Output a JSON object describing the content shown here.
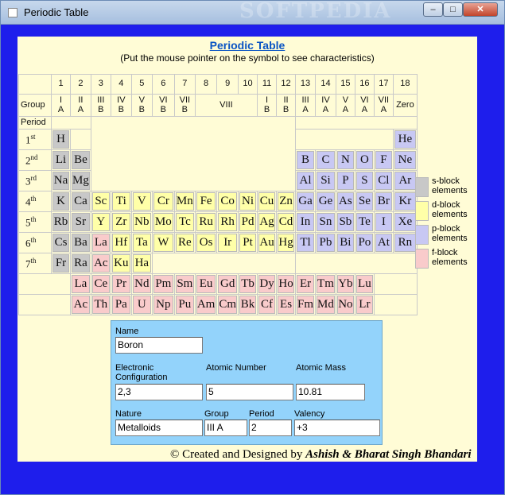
{
  "window": {
    "title": "Periodic Table",
    "watermark": "SOFTPEDIA",
    "minimize": "–",
    "maximize": "□",
    "close": "✕"
  },
  "header": {
    "title": "Periodic Table",
    "subtitle": "(Put the mouse pointer on the symbol to see characteristics)"
  },
  "table": {
    "group_label": "Group",
    "period_label": "Period",
    "zero_label": "Zero",
    "viii_label": "VIII",
    "group_numbers": [
      "1",
      "2",
      "3",
      "4",
      "5",
      "6",
      "7",
      "8",
      "9",
      "10",
      "11",
      "12",
      "13",
      "14",
      "15",
      "16",
      "17",
      "18"
    ],
    "group_names": [
      "I\nA",
      "II\nA",
      "III\nB",
      "IV\nB",
      "V\nB",
      "VI\nB",
      "VII\nB",
      "",
      "",
      "",
      "I\nB",
      "II\nB",
      "III\nA",
      "IV\nA",
      "V\nA",
      "VI\nA",
      "VII\nA"
    ],
    "periods": [
      "1st",
      "2nd",
      "3rd",
      "4th",
      "5th",
      "6th",
      "7th"
    ],
    "rows": [
      {
        "left": [
          "H"
        ],
        "right": [
          "He"
        ]
      },
      {
        "left": [
          "Li",
          "Be"
        ],
        "right": [
          "B",
          "C",
          "N",
          "O",
          "F",
          "Ne"
        ]
      },
      {
        "left": [
          "Na",
          "Mg"
        ],
        "right": [
          "Al",
          "Si",
          "P",
          "S",
          "Cl",
          "Ar"
        ]
      },
      {
        "left": [
          "K",
          "Ca"
        ],
        "d": [
          "Sc",
          "Ti",
          "V",
          "Cr",
          "Mn",
          "Fe",
          "Co",
          "Ni",
          "Cu",
          "Zn"
        ],
        "right": [
          "Ga",
          "Ge",
          "As",
          "Se",
          "Br",
          "Kr"
        ]
      },
      {
        "left": [
          "Rb",
          "Sr"
        ],
        "d": [
          "Y",
          "Zr",
          "Nb",
          "Mo",
          "Tc",
          "Ru",
          "Rh",
          "Pd",
          "Ag",
          "Cd"
        ],
        "right": [
          "In",
          "Sn",
          "Sb",
          "Te",
          "I",
          "Xe"
        ]
      },
      {
        "left": [
          "Cs",
          "Ba"
        ],
        "d": [
          "La",
          "Hf",
          "Ta",
          "W",
          "Re",
          "Os",
          "Ir",
          "Pt",
          "Au",
          "Hg"
        ],
        "right": [
          "Tl",
          "Pb",
          "Bi",
          "Po",
          "At",
          "Rn"
        ]
      },
      {
        "left": [
          "Fr",
          "Ra"
        ],
        "d": [
          "Ac",
          "Ku",
          "Ha"
        ]
      }
    ],
    "lanthanides": [
      "La",
      "Ce",
      "Pr",
      "Nd",
      "Pm",
      "Sm",
      "Eu",
      "Gd",
      "Tb",
      "Dy",
      "Ho",
      "Er",
      "Tm",
      "Yb",
      "Lu"
    ],
    "actinides": [
      "Ac",
      "Th",
      "Pa",
      "U",
      "Np",
      "Pu",
      "Am",
      "Cm",
      "Bk",
      "Cf",
      "Es",
      "Fm",
      "Md",
      "No",
      "Lr"
    ]
  },
  "legend": [
    {
      "label": "s-block elements",
      "color": "#c8c8c8"
    },
    {
      "label": "d-block elements",
      "color": "#ffffa8"
    },
    {
      "label": "p-block elements",
      "color": "#c8c8f3"
    },
    {
      "label": "f-block elements",
      "color": "#f9cbcb"
    }
  ],
  "info": {
    "name_label": "Name",
    "name": "Boron",
    "config_label": "Electronic Configuration",
    "config": "2,3",
    "number_label": "Atomic Number",
    "number": "5",
    "mass_label": "Atomic Mass",
    "mass": "10.81",
    "nature_label": "Nature",
    "nature": "Metalloids",
    "group_label": "Group",
    "group": "III A",
    "period_label": "Period",
    "period": "2",
    "valency_label": "Valency",
    "valency": "+3"
  },
  "credit": {
    "prefix": "© Created and Designed by ",
    "authors": "Ashish & Bharat Singh Bhandari"
  }
}
